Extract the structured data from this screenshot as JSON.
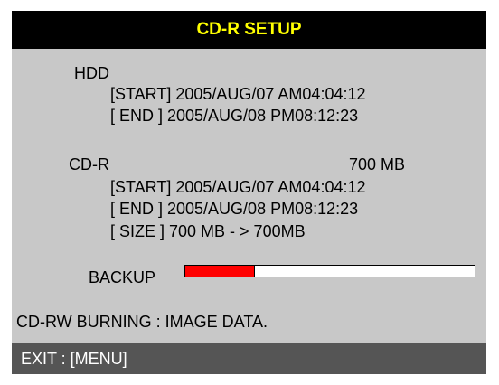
{
  "title": "CD-R SETUP",
  "hdd": {
    "label": "HDD",
    "start": "[START] 2005/AUG/07 AM04:04:12",
    "end": "[ END ] 2005/AUG/08 PM08:12:23"
  },
  "cdr": {
    "label": "CD-R",
    "capacity": "700 MB",
    "start": "[START] 2005/AUG/07 AM04:04:12",
    "end": "[ END ] 2005/AUG/08 PM08:12:23",
    "size": "[ SIZE ] 700 MB - > 700MB"
  },
  "backup": {
    "label": "BACKUP",
    "progress_fraction": 0.24
  },
  "status": "CD-RW BURNING : IMAGE DATA.",
  "footer": "EXIT : [MENU]",
  "colors": {
    "header_bg": "#000000",
    "header_text": "#ffff00",
    "body_bg": "#c8c8c8",
    "footer_bg": "#555555",
    "progress_fill": "#ff0000"
  }
}
